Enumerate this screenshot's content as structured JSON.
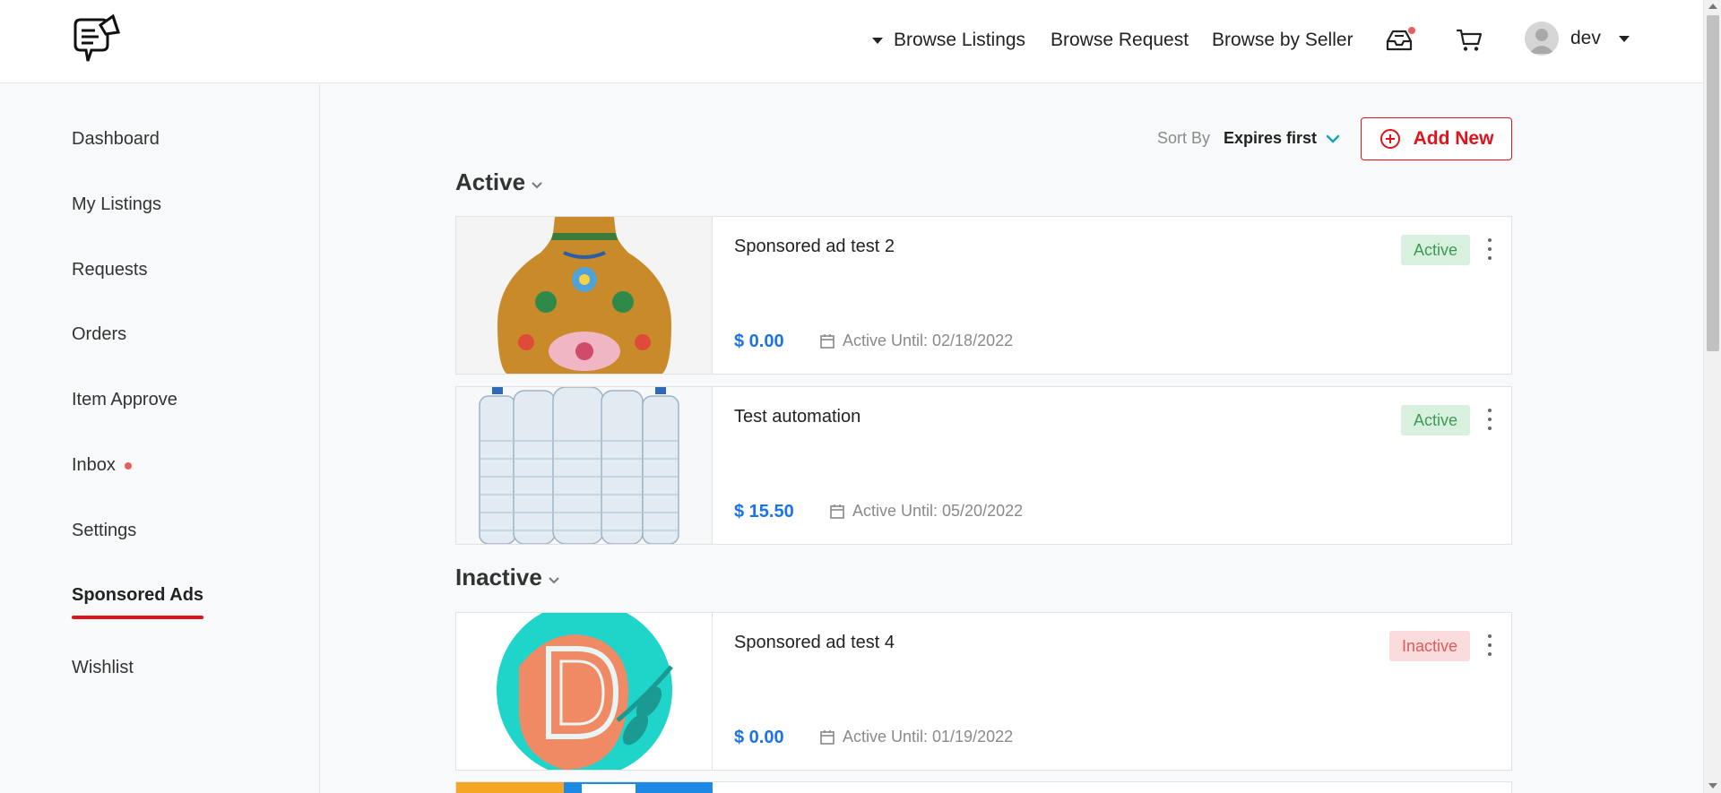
{
  "header": {
    "nav": {
      "browse_listings": "Browse Listings",
      "browse_request": "Browse Request",
      "browse_by_seller": "Browse by Seller"
    },
    "user": {
      "name": "dev"
    }
  },
  "sidebar": {
    "items": [
      {
        "label": "Dashboard"
      },
      {
        "label": "My Listings"
      },
      {
        "label": "Requests"
      },
      {
        "label": "Orders"
      },
      {
        "label": "Item Approve"
      },
      {
        "label": "Inbox"
      },
      {
        "label": "Settings"
      },
      {
        "label": "Sponsored Ads"
      },
      {
        "label": "Wishlist"
      }
    ],
    "active_item": "Sponsored Ads"
  },
  "toolbar": {
    "sort_label": "Sort By",
    "sort_value": "Expires first",
    "add_new_label": "Add New"
  },
  "sections": {
    "active": {
      "title": "Active",
      "cards": [
        {
          "title": "Sponsored ad test 2",
          "price": "$ 0.00",
          "date": "Active Until: 02/18/2022",
          "status": "Active",
          "image": "vase"
        },
        {
          "title": "Test automation",
          "price": "$ 15.50",
          "date": "Active Until: 05/20/2022",
          "status": "Active",
          "image": "water-bottles"
        }
      ]
    },
    "inactive": {
      "title": "Inactive",
      "cards": [
        {
          "title": "Sponsored ad test 4",
          "price": "$ 0.00",
          "date": "Active Until: 01/19/2022",
          "status": "Inactive",
          "image": "d-logo"
        }
      ]
    }
  },
  "colors": {
    "accent_red": "#e0131b",
    "price_blue": "#1a73e8",
    "active_badge_bg": "#d8f0de",
    "active_badge_text": "#3d9a55",
    "inactive_badge_bg": "#fbdcdc",
    "inactive_badge_text": "#e05a5a",
    "sort_chevron": "#17a2b8"
  }
}
